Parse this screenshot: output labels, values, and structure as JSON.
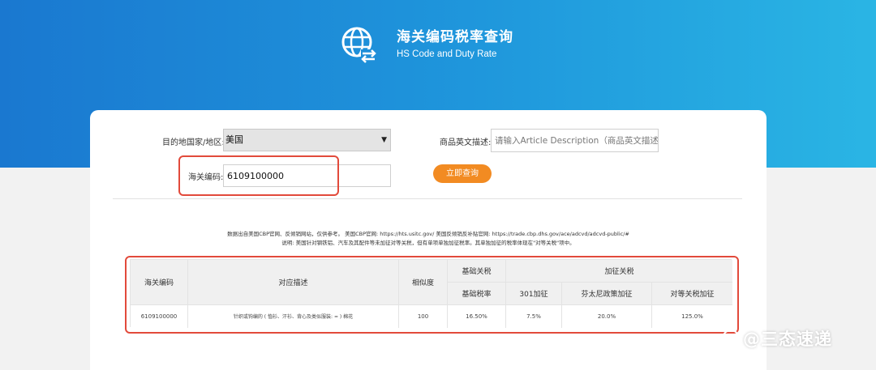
{
  "header": {
    "title": "海关编码税率查询",
    "subtitle": "HS Code and Duty Rate",
    "brand_color": "#1f8fd9"
  },
  "form": {
    "country_label": "目的地国家/地区:",
    "country_value": "美国",
    "description_label": "商品英文描述:",
    "description_placeholder": "请输入Article Description（商品英文描述）",
    "hs_label": "海关编码:",
    "hs_value": "6109100000",
    "search_label": "立即查询",
    "button_color": "#f28b22"
  },
  "notes": {
    "line1": "数据出自美国CBP官网、反倾销网站，仅供参考。   美国CBP官网: https://hts.usitc.gov/   美国反倾销反补贴官网: https://trade.cbp.dhs.gov/ace/adcvd/adcvd-public/#",
    "line2": "说明: 美国针对钢铁铝、汽车及其配件等未加征对等关税，但有单项单独加征税率。其单独加征的税率体现在\"对等关税\"项中。"
  },
  "table": {
    "headers": {
      "hs_code": "海关编码",
      "description": "对应描述",
      "similarity": "相似度",
      "base_group": "基础关税",
      "base_rate": "基础税率",
      "extra_group": "加征关税",
      "s301": "301加征",
      "fentanyl": "芬太尼政策加征",
      "reciprocal": "对等关税加征"
    },
    "rows": [
      {
        "hs_code": "6109100000",
        "description": "针织或钩编的 ( 恤衫、汗衫、背心及类似服装: = ) 棉花",
        "similarity": "100",
        "base_rate": "16.50%",
        "s301": "7.5%",
        "fentanyl": "20.0%",
        "reciprocal": "125.0%"
      }
    ]
  },
  "watermark": {
    "badge": "du",
    "text": "@三态速递"
  },
  "highlight_color": "#e24a3b"
}
